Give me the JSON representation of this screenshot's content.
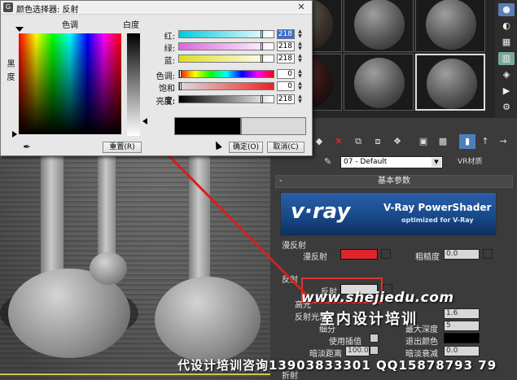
{
  "dialog": {
    "title": "颜色选择器: 反射",
    "hue_label": "色调",
    "whiteness_label": "白度",
    "blackness_label": "黑度",
    "rows": [
      {
        "label": "红:",
        "value": "218",
        "highlight": true
      },
      {
        "label": "绿:",
        "value": "218",
        "highlight": false
      },
      {
        "label": "蓝:",
        "value": "218",
        "highlight": false
      },
      {
        "label": "色调:",
        "value": "0",
        "highlight": false
      },
      {
        "label": "饱和度:",
        "value": "0",
        "highlight": false
      },
      {
        "label": "亮度:",
        "value": "218",
        "highlight": false
      }
    ],
    "reset_button": "重置(R)",
    "ok_button": "确定(O)",
    "cancel_button": "取消(C)",
    "old_color": "#000000",
    "new_color": "#dadada",
    "close_icon": "close-icon",
    "eyedropper_icon": "eyedropper-icon"
  },
  "editor": {
    "material_name": "07 - Default",
    "material_type": "VR材质",
    "rollout_title": "基本参数",
    "rollout_toggle": "-",
    "banner": {
      "logo": "v·ray",
      "title": "V-Ray PowerShader",
      "subtitle": "optimized for V-Ray"
    },
    "diffuse_group": "漫反射",
    "diffuse_label": "漫反射",
    "diffuse_color": "#e0242b",
    "roughness_label": "粗糙度",
    "roughness_value": "0.0",
    "reflection_group": "反射",
    "reflect_label": "反射",
    "reflect_color": "#dadada",
    "hilight_label": "高光",
    "refl_gloss_label": "反射光泽",
    "subdivs_label": "细分",
    "use_interp_label": "使用插值",
    "dim_distance_label": "暗淡距离",
    "dim_distance_value": "100.0",
    "fresnel_ior_value": "1.6",
    "max_depth_label": "最大深度",
    "max_depth_value": "5",
    "exit_color_label": "退出颜色",
    "exit_color": "#000000",
    "dim_falloff_label": "暗淡衰减",
    "dim_falloff_value": "0.0",
    "refraction_group": "折射"
  },
  "watermark": {
    "site": "www.shejiedu.com",
    "brand": "室内设计培训",
    "contact": "代设计培训咨询13903833301 QQ15878793 79"
  }
}
